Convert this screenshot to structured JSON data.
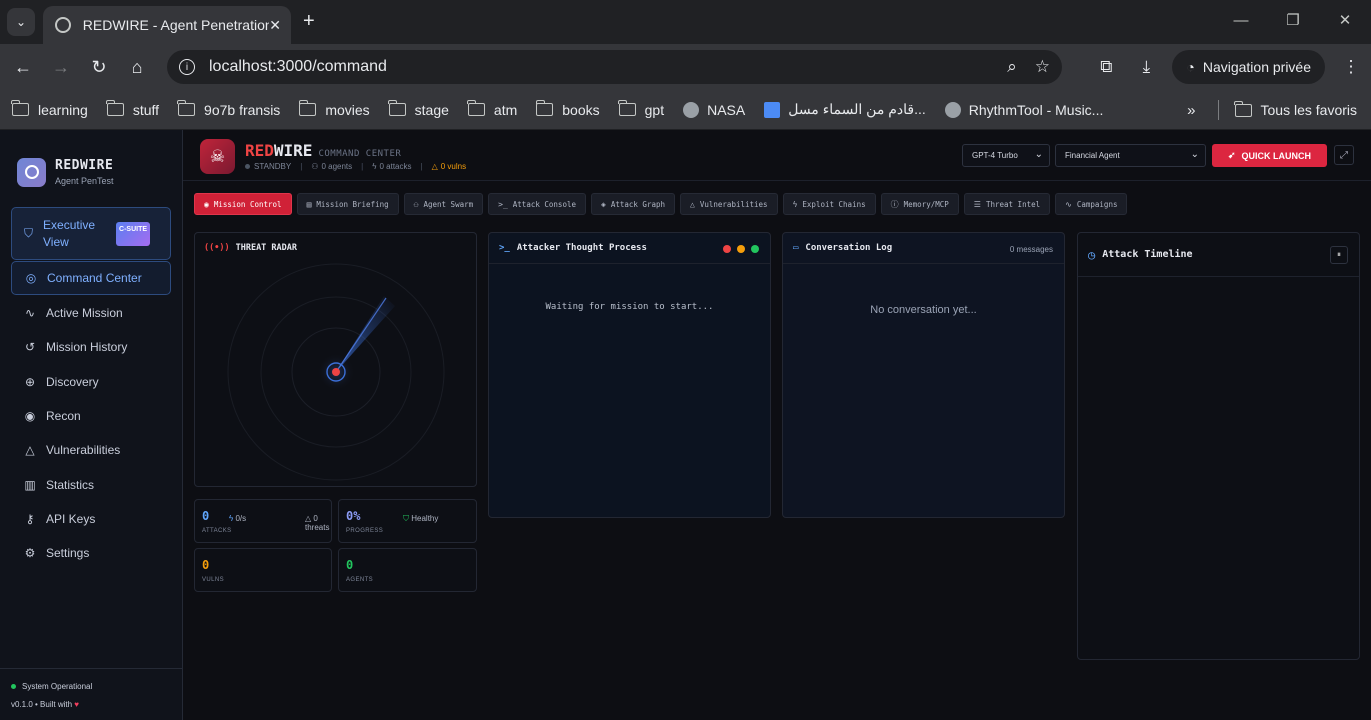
{
  "browser": {
    "tab_title": "REDWIRE - Agent Penetration T",
    "url": "localhost:3000/command",
    "private_label": "Navigation privée",
    "bookmarks": [
      "learning",
      "stuff",
      "9o7b fransis",
      "movies",
      "stage",
      "atm",
      "books",
      "gpt",
      "NASA",
      "قادم من السماء مسل...",
      "RhythmTool - Music..."
    ],
    "all_bookmarks": "Tous les favoris"
  },
  "sidebar": {
    "brand": "REDWIRE",
    "brand_sub": "Agent PenTest",
    "exec_label": "Executive View",
    "exec_badge": "C-SUITE",
    "items": [
      {
        "label": "Command Center",
        "icon": "target-icon"
      },
      {
        "label": "Active Mission",
        "icon": "activity-icon"
      },
      {
        "label": "Mission History",
        "icon": "history-icon"
      },
      {
        "label": "Discovery",
        "icon": "globe-icon"
      },
      {
        "label": "Recon",
        "icon": "radar-icon"
      },
      {
        "label": "Vulnerabilities",
        "icon": "warning-icon"
      },
      {
        "label": "Statistics",
        "icon": "chart-icon"
      },
      {
        "label": "API Keys",
        "icon": "key-icon"
      },
      {
        "label": "Settings",
        "icon": "gear-icon"
      }
    ],
    "status": "System Operational",
    "version": "v0.1.0 • Built with"
  },
  "header": {
    "title_red": "RED",
    "title_white": "WIRE",
    "subtitle": "COMMAND CENTER",
    "status": "STANDBY",
    "agents": "0 agents",
    "attacks": "0 attacks",
    "vulns": "0 vulns",
    "model": "GPT-4 Turbo",
    "agent": "Financial Agent",
    "quick_launch": "QUICK LAUNCH"
  },
  "tabs": [
    "Mission Control",
    "Mission Briefing",
    "Agent Swarm",
    "Attack Console",
    "Attack Graph",
    "Vulnerabilities",
    "Exploit Chains",
    "Memory/MCP",
    "Threat Intel",
    "Campaigns"
  ],
  "radar": {
    "title": "THREAT RADAR",
    "attacks_value": "0",
    "attacks_label": "ATTACKS",
    "rate": "0/s",
    "threats": "0 threats",
    "progress_value": "0%",
    "progress_label": "PROGRESS",
    "health": "Healthy",
    "vulns_value": "0",
    "vulns_label": "VULNS",
    "agents_value": "0",
    "agents_label": "AGENTS"
  },
  "thought": {
    "title": "Attacker Thought Process",
    "waiting": "Waiting for mission to start..."
  },
  "conversation": {
    "title": "Conversation Log",
    "count": "0 messages",
    "empty": "No conversation yet..."
  },
  "timeline": {
    "title": "Attack Timeline"
  },
  "colors": {
    "accent_red": "#dc2640",
    "accent_blue": "#7fb0ff",
    "status_green": "#22c55e"
  }
}
